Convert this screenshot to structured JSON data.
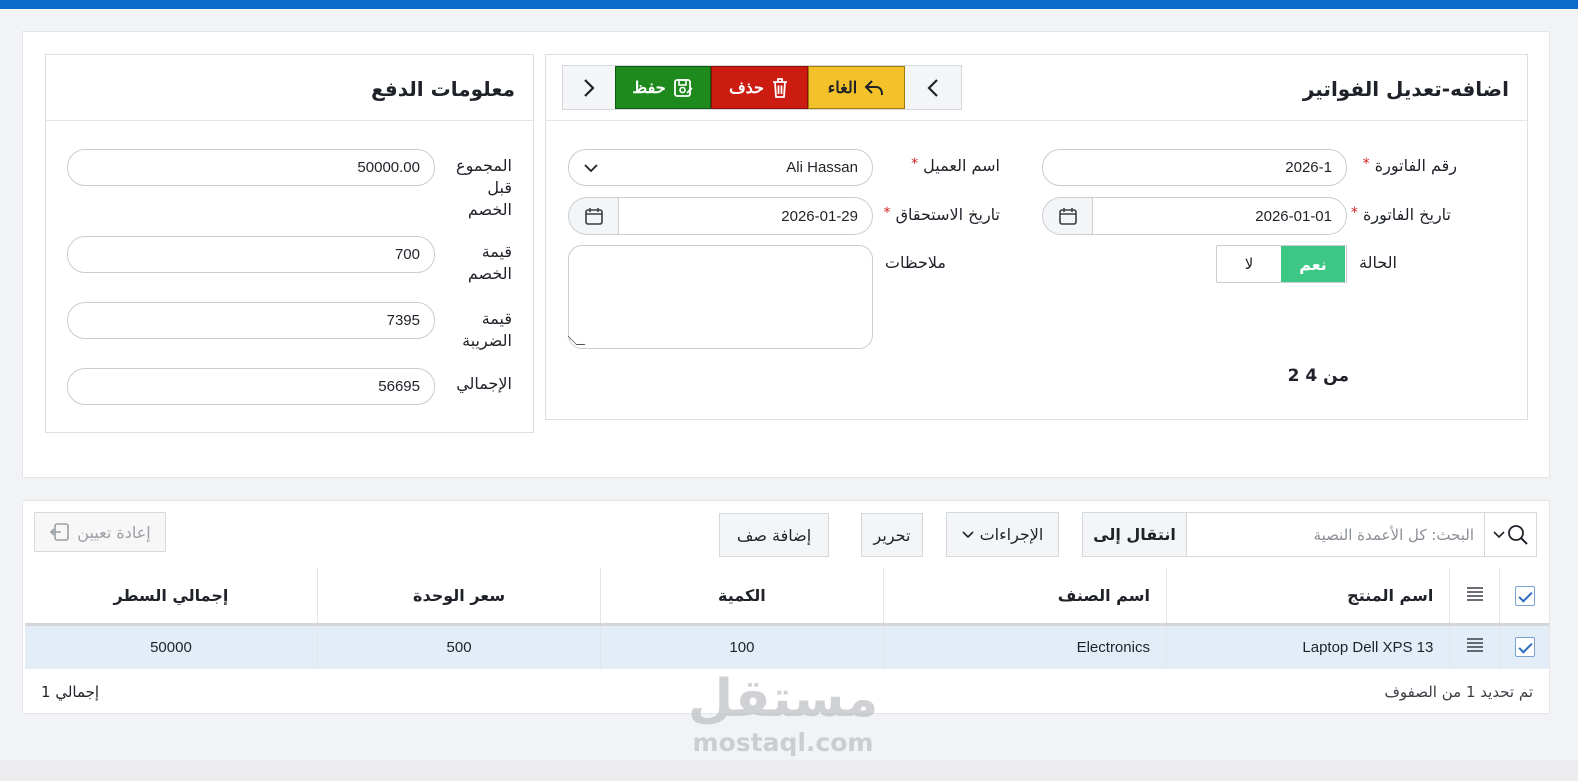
{
  "invoice_panel": {
    "title": "اضافه-تعديل الفواتير",
    "toolbar": {
      "prev_label": "‹",
      "cancel_label": "الغاء",
      "delete_label": "حذف",
      "save_label": "حفظ",
      "next_label": "›"
    },
    "fields": {
      "invoice_number_label": "رقم الفاتورة",
      "invoice_number_value": "2026-1",
      "customer_label": "اسم العميل",
      "customer_value": "Ali Hassan",
      "invoice_date_label": "تاريخ الفاتورة",
      "invoice_date_value": "2026-01-01",
      "due_date_label": "تاريخ الاستحقاق",
      "due_date_value": "2026-01-29",
      "status_label": "الحالة",
      "status_yes": "نعم",
      "status_no": "لا",
      "status_selected": "نعم",
      "notes_label": "ملاحظات",
      "notes_value": "",
      "required_mark": "*"
    },
    "record_counter": "2 من 4"
  },
  "payment_panel": {
    "title": "معلومات الدفع",
    "subtotal_label": "المجموع قبل الخصم",
    "subtotal_value": "50000.00",
    "discount_label": "قيمة الخصم",
    "discount_value": "700",
    "tax_label": "قيمة الضريبة",
    "tax_value": "7395",
    "total_label": "الإجمالي",
    "total_value": "56695"
  },
  "grid": {
    "search_placeholder": "البحث: كل الأعمدة النصية",
    "goto_label": "انتقال إلى",
    "actions_label": "الإجراءات",
    "edit_label": "تحرير",
    "add_row_label": "إضافة صف",
    "reset_label": "إعادة تعيين",
    "columns": [
      "اسم المنتج",
      "اسم الصنف",
      "الكمية",
      "سعر الوحدة",
      "إجمالي السطر"
    ],
    "rows": [
      {
        "product": "Laptop Dell XPS 13",
        "category": "Electronics",
        "quantity": "100",
        "unit_price": "500",
        "line_total": "50000"
      }
    ],
    "selection_status": "تم تحديد 1 من الصفوف",
    "total_count": "إجمالي 1"
  },
  "watermark": {
    "arabic": "مستقل",
    "latin": "mostaql.com"
  },
  "colors": {
    "accent": "#0b6bcb",
    "save": "#1e8a1e",
    "delete": "#cc1b10",
    "cancel": "#f3c22a",
    "toggle_on": "#3cc884",
    "selected_row": "#e3edf8"
  }
}
